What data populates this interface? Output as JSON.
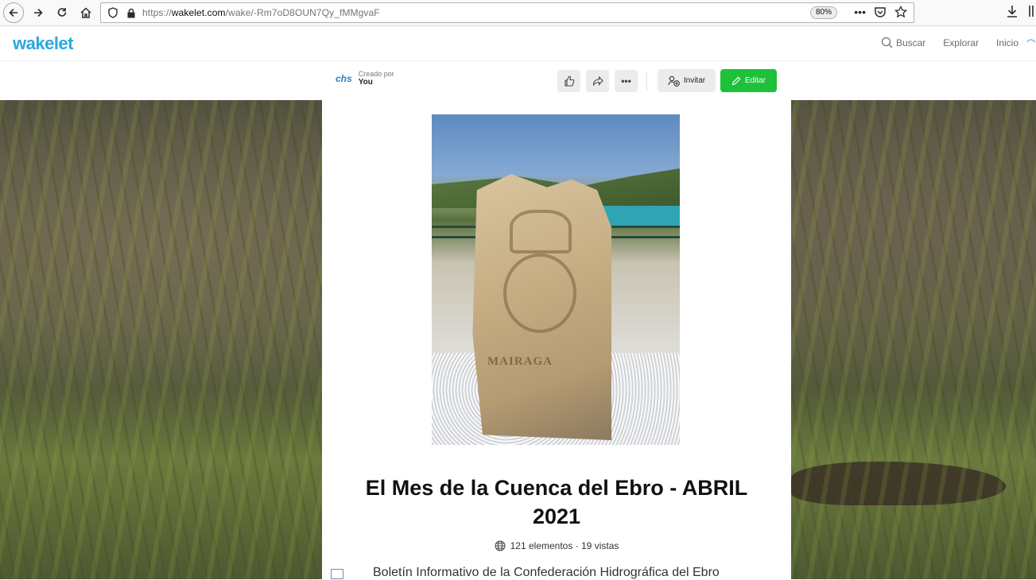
{
  "browser": {
    "url_prefix": "https://",
    "url_domain": "wakelet.com",
    "url_path": "/wake/-Rm7oD8OUN7Qy_fMMgvaF",
    "zoom": "80%",
    "icons": [
      "back-icon",
      "forward-icon",
      "reload-icon",
      "home-icon",
      "shield-icon",
      "lock-icon",
      "more-icon",
      "pocket-icon",
      "bookmark-star-icon",
      "download-icon",
      "library-icon"
    ]
  },
  "header": {
    "logo": "wakelet",
    "nav": {
      "search": "Buscar",
      "explore": "Explorar",
      "home": "Inicio"
    }
  },
  "subbar": {
    "creator_logo": "chs",
    "creator_label": "Creado por",
    "creator_name": "You",
    "invite_label": "Invitar",
    "edit_label": "Editar",
    "accent_color": "#1ec13a"
  },
  "collection": {
    "cover_text": "MAIRAGA",
    "title": "El Mes de la Cuenca del Ebro - ABRIL 2021",
    "meta": "121 elementos · 19 vistas",
    "description": "Boletín Informativo de la Confederación Hidrográfica del Ebro"
  }
}
